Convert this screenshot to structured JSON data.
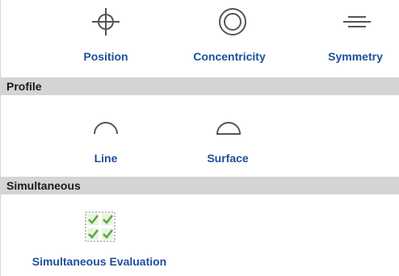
{
  "location_group": {
    "items": [
      {
        "label": "Position",
        "icon": "position-icon"
      },
      {
        "label": "Concentricity",
        "icon": "concentricity-icon"
      },
      {
        "label": "Symmetry",
        "icon": "symmetry-icon"
      }
    ]
  },
  "profile_section": {
    "title": "Profile",
    "items": [
      {
        "label": "Line",
        "icon": "line-profile-icon"
      },
      {
        "label": "Surface",
        "icon": "surface-profile-icon"
      }
    ]
  },
  "simultaneous_section": {
    "title": "Simultaneous",
    "items": [
      {
        "label": "Simultaneous Evaluation",
        "icon": "simultaneous-evaluation-icon"
      }
    ]
  },
  "colors": {
    "label": "#1f4f9a",
    "header_bg": "#d4d4d4",
    "icon_stroke": "#555555",
    "check_green": "#5aa83a"
  }
}
